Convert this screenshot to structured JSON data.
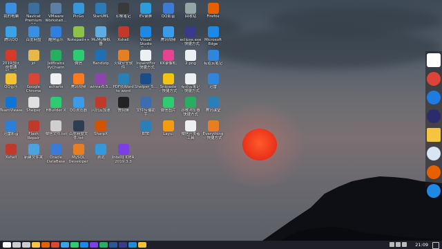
{
  "desktop_icons": [
    {
      "label": "我的电脑",
      "color": "#3a8fe0"
    },
    {
      "label": "腾讯QQ",
      "color": "#3aa3e8"
    },
    {
      "label": "2019国庆\n放假通知.pdf",
      "color": "#d63b2a"
    },
    {
      "label": "QQ音乐",
      "color": "#f2c230"
    },
    {
      "label": "TeamViewer",
      "color": "#0e74d6"
    },
    {
      "label": "迅雷影音",
      "color": "#2a7fd8"
    },
    {
      "label": "Xshell",
      "color": "#c0392b"
    },
    {
      "label": "Navicat\nPremium 12",
      "color": "#3c6e9e"
    },
    {
      "label": "百度网盘",
      "color": "#3a8fe0"
    },
    {
      "label": "jcl",
      "color": "#e6b84a"
    },
    {
      "label": "Google\nChrome",
      "color": "#db4437"
    },
    {
      "label": "Shelper",
      "color": "#e0e0e0"
    },
    {
      "label": "Flash Repair",
      "color": "#c0392b"
    },
    {
      "label": "新建文件夹",
      "color": "#4aa3df"
    },
    {
      "label": "VMware\nWorkstati...",
      "color": "#5d7fa3"
    },
    {
      "label": "酷狗音乐",
      "color": "#2f7fe0"
    },
    {
      "label": "JetBrains\nPyCharm",
      "color": "#27ae60"
    },
    {
      "label": "echarts",
      "color": "#f0f0f0"
    },
    {
      "label": "HBuilder X",
      "color": "#2ecc71"
    },
    {
      "label": "微信文件.txt",
      "color": "#cfcfcf"
    },
    {
      "label": "Oracle\nDataBase",
      "color": "#3a7bd5"
    },
    {
      "label": "PicGo",
      "color": "#3498db"
    },
    {
      "label": "Notepad++",
      "color": "#8bc34a"
    },
    {
      "label": "微信",
      "color": "#2ecc71"
    },
    {
      "label": "腾讯视频",
      "color": "#ff7a1a"
    },
    {
      "label": "QQ浏览器",
      "color": "#3a9be8"
    },
    {
      "label": "百度网盘文件.txt",
      "color": "#2c3e50"
    },
    {
      "label": "MySQL\nDeveloper",
      "color": "#e67e22"
    },
    {
      "label": "StarUML",
      "color": "#2c7bb6"
    },
    {
      "label": "MuMu模拟器",
      "color": "#5dade2"
    },
    {
      "label": "Bandizip",
      "color": "#1f6fb2"
    },
    {
      "label": "winrar5.5...",
      "color": "#8e44ad"
    },
    {
      "label": "闪讯云加速",
      "color": "#c0392b"
    },
    {
      "label": "SharpX",
      "color": "#d35400"
    },
    {
      "label": "测试",
      "color": "#3498db"
    },
    {
      "label": "印象笔记",
      "color": "#3a3a3a"
    },
    {
      "label": "Xshell",
      "color": "#c0392b"
    },
    {
      "label": "火绒安全软件",
      "color": "#e67e22"
    },
    {
      "label": "PDF转Word\nto word",
      "color": "#2980b9"
    },
    {
      "label": "快剪辑",
      "color": "#222"
    },
    {
      "label": "",
      "color": "#000"
    },
    {
      "label": "IntelliJ IDEA\n2019.3.3",
      "color": "#7b3fe4"
    },
    {
      "label": "EV录屏",
      "color": "#2d9cdb"
    },
    {
      "label": "Visual\nStudio Code",
      "color": "#1e88e5"
    },
    {
      "label": "InpaintFor\n- 快捷方式",
      "color": "#ecf0f1"
    },
    {
      "label": "Shelper_5...",
      "color": "#1a4e8a"
    },
    {
      "label": "文件传输助手",
      "color": "#3b6db0"
    },
    {
      "label": "BTE",
      "color": "#2980b9"
    },
    {
      "label": "",
      "color": "#000"
    },
    {
      "label": "QQ影音",
      "color": "#3a7bd5"
    },
    {
      "label": "腾讯视频",
      "color": "#3a9be8"
    },
    {
      "label": "KK录像机",
      "color": "#e84393"
    },
    {
      "label": "Snipaste\n- 快捷方式",
      "color": "#f1c40f"
    },
    {
      "label": "微信图片",
      "color": "#2ecc71"
    },
    {
      "label": "Layui",
      "color": "#f39c12"
    },
    {
      "label": "",
      "color": "#000"
    },
    {
      "label": "回收站",
      "color": "#95a5a6"
    },
    {
      "label": "eclipse.exe\n- 快捷方式",
      "color": "#3a3a8a"
    },
    {
      "label": "2.png",
      "color": "#ecf0f1"
    },
    {
      "label": "有道云笔记\n- 快捷方式",
      "color": "#ecf0f1"
    },
    {
      "label": "谷歌浏览器\n快捷方式",
      "color": "#27ae60"
    },
    {
      "label": "微信开发者工具",
      "color": "#ecf0f1"
    },
    {
      "label": "",
      "color": "#000"
    },
    {
      "label": "Firefox",
      "color": "#e66000"
    },
    {
      "label": "Microsoft\nEdge",
      "color": "#1e88e5"
    },
    {
      "label": "有道云笔记",
      "color": "#2e86de"
    },
    {
      "label": "迅雷",
      "color": "#2e86de"
    },
    {
      "label": "腾讯课堂",
      "color": "#2980b9"
    },
    {
      "label": "Everything\n- 快捷方式",
      "color": "#e67e22"
    },
    {
      "label": "",
      "color": "#000"
    }
  ],
  "dock": [
    {
      "name": "start-tile",
      "color": "#ffffff"
    },
    {
      "name": "chrome",
      "color": "#db4437"
    },
    {
      "name": "kugou",
      "color": "#1e7be0"
    },
    {
      "name": "eclipse",
      "color": "#2c2c6c"
    },
    {
      "name": "folder",
      "color": "#f5c542"
    },
    {
      "name": "settings",
      "color": "#d7e6f5"
    },
    {
      "name": "firefox",
      "color": "#e66000"
    },
    {
      "name": "edge",
      "color": "#1e88e5"
    }
  ],
  "taskbar": {
    "items": [
      {
        "name": "start",
        "color": "#ffffff"
      },
      {
        "name": "search",
        "color": "#cccccc"
      },
      {
        "name": "task-view",
        "color": "#cccccc"
      },
      {
        "name": "file-explorer",
        "color": "#f5c542"
      },
      {
        "name": "firefox",
        "color": "#e66000"
      },
      {
        "name": "chrome",
        "color": "#db4437"
      },
      {
        "name": "qq",
        "color": "#3aa3e8"
      },
      {
        "name": "wechat",
        "color": "#2ecc71"
      },
      {
        "name": "vscode",
        "color": "#1e88e5"
      },
      {
        "name": "idea",
        "color": "#7b3fe4"
      },
      {
        "name": "pycharm",
        "color": "#27ae60"
      },
      {
        "name": "word",
        "color": "#2b579a"
      },
      {
        "name": "eclipse",
        "color": "#3a3a8a"
      },
      {
        "name": "photoshop",
        "color": "#1b8fd6"
      },
      {
        "name": "music",
        "color": "#f2c230"
      }
    ],
    "clock": "21:09"
  }
}
